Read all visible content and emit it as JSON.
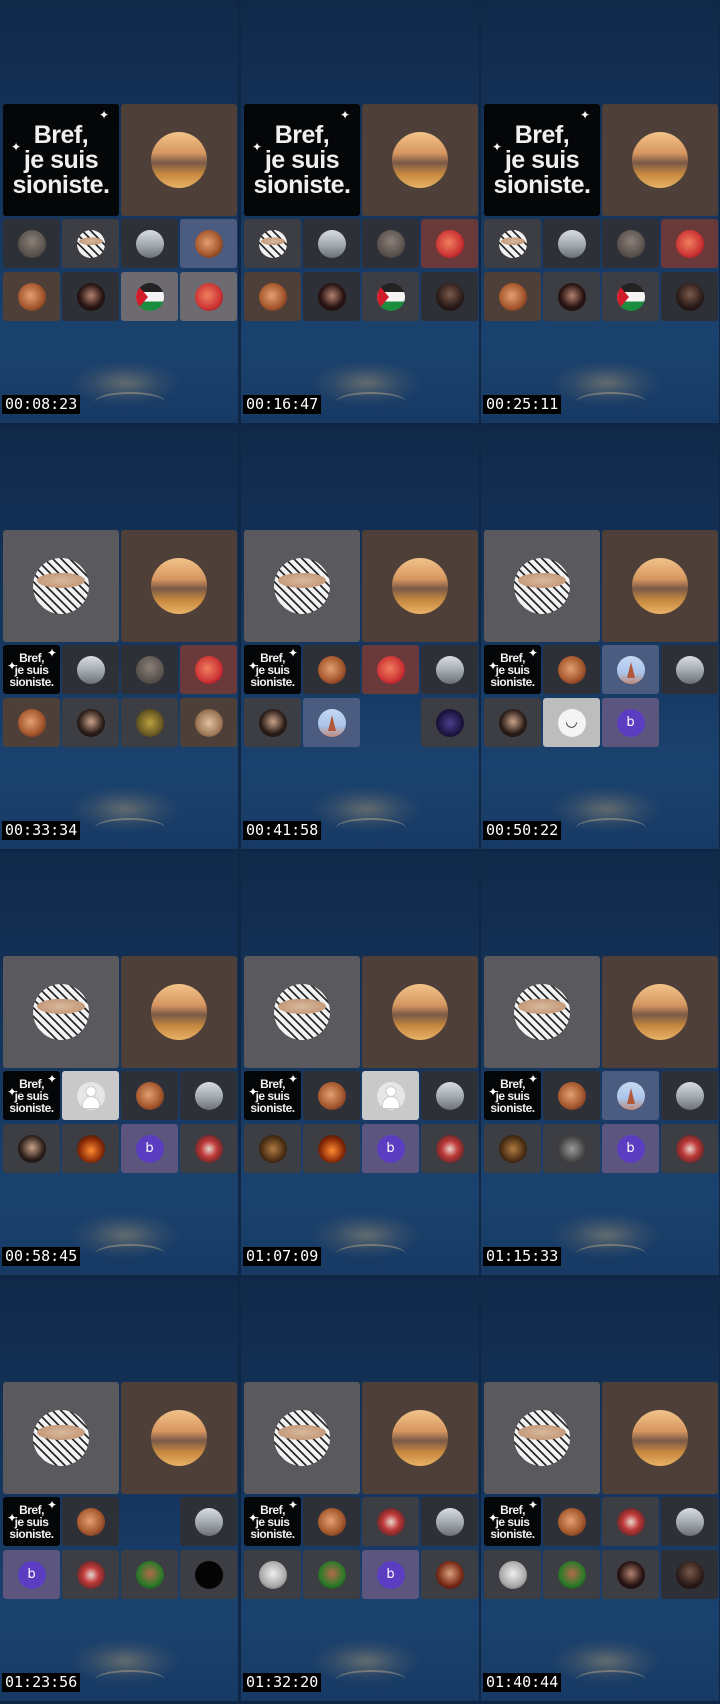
{
  "bref_text": "Bref,\nje suis\nsioniste.",
  "frames": [
    {
      "timestamp": "00:08:23",
      "tiles": [
        {
          "size": "big",
          "bg": "bref",
          "avatar": "bref"
        },
        {
          "size": "big",
          "bg": "tan",
          "avatar": "city"
        },
        {
          "size": "small",
          "bg": "dark",
          "avatar": "face"
        },
        {
          "size": "small",
          "bg": "grey",
          "avatar": "keffiyeh"
        },
        {
          "size": "small",
          "bg": "dark",
          "avatar": "car"
        },
        {
          "size": "small",
          "bg": "blue",
          "avatar": "orange"
        },
        {
          "size": "small",
          "bg": "tan",
          "avatar": "orange"
        },
        {
          "size": "small",
          "bg": "dark",
          "avatar": "woman"
        },
        {
          "size": "small",
          "bg": "light",
          "avatar": "flag"
        },
        {
          "size": "small",
          "bg": "light",
          "avatar": "red"
        }
      ]
    },
    {
      "timestamp": "00:16:47",
      "tiles": [
        {
          "size": "big",
          "bg": "bref",
          "avatar": "bref"
        },
        {
          "size": "big",
          "bg": "tan",
          "avatar": "city"
        },
        {
          "size": "small",
          "bg": "grey",
          "avatar": "keffiyeh"
        },
        {
          "size": "small",
          "bg": "dark",
          "avatar": "car"
        },
        {
          "size": "small",
          "bg": "dark",
          "avatar": "face"
        },
        {
          "size": "small",
          "bg": "red",
          "avatar": "red"
        },
        {
          "size": "small",
          "bg": "tan",
          "avatar": "orange"
        },
        {
          "size": "small",
          "bg": "dark",
          "avatar": "woman"
        },
        {
          "size": "small",
          "bg": "grey",
          "avatar": "flag"
        },
        {
          "size": "small",
          "bg": "dark",
          "avatar": "dark"
        }
      ]
    },
    {
      "timestamp": "00:25:11",
      "tiles": [
        {
          "size": "big",
          "bg": "bref",
          "avatar": "bref"
        },
        {
          "size": "big",
          "bg": "tan",
          "avatar": "city"
        },
        {
          "size": "small",
          "bg": "grey",
          "avatar": "keffiyeh"
        },
        {
          "size": "small",
          "bg": "dark",
          "avatar": "car"
        },
        {
          "size": "small",
          "bg": "dark",
          "avatar": "face"
        },
        {
          "size": "small",
          "bg": "red",
          "avatar": "red"
        },
        {
          "size": "small",
          "bg": "tan",
          "avatar": "orange"
        },
        {
          "size": "small",
          "bg": "grey",
          "avatar": "woman"
        },
        {
          "size": "small",
          "bg": "grey",
          "avatar": "flag"
        },
        {
          "size": "small",
          "bg": "dark",
          "avatar": "dark"
        }
      ]
    },
    {
      "timestamp": "00:33:34",
      "tiles": [
        {
          "size": "big",
          "bg": "gray2",
          "avatar": "keffiyeh"
        },
        {
          "size": "big",
          "bg": "tan",
          "avatar": "city"
        },
        {
          "size": "small",
          "bg": "bref",
          "avatar": "bref"
        },
        {
          "size": "small",
          "bg": "dark",
          "avatar": "car"
        },
        {
          "size": "small",
          "bg": "dark",
          "avatar": "face"
        },
        {
          "size": "small",
          "bg": "red",
          "avatar": "red"
        },
        {
          "size": "small",
          "bg": "tan",
          "avatar": "orange"
        },
        {
          "size": "small",
          "bg": "grey",
          "avatar": "beard"
        },
        {
          "size": "small",
          "bg": "grey",
          "avatar": "gold"
        },
        {
          "size": "small",
          "bg": "tan",
          "avatar": "hands"
        }
      ]
    },
    {
      "timestamp": "00:41:58",
      "tiles": [
        {
          "size": "big",
          "bg": "gray2",
          "avatar": "keffiyeh"
        },
        {
          "size": "big",
          "bg": "tan",
          "avatar": "city"
        },
        {
          "size": "small",
          "bg": "bref",
          "avatar": "bref"
        },
        {
          "size": "small",
          "bg": "dark",
          "avatar": "orange"
        },
        {
          "size": "small",
          "bg": "red",
          "avatar": "red"
        },
        {
          "size": "small",
          "bg": "dark",
          "avatar": "car"
        },
        {
          "size": "small",
          "bg": "grey",
          "avatar": "beard"
        },
        {
          "size": "small",
          "bg": "blue",
          "avatar": "eiffel"
        },
        {
          "size": "small",
          "bg": "none",
          "avatar": "none"
        },
        {
          "size": "small",
          "bg": "grey",
          "avatar": "night"
        }
      ]
    },
    {
      "timestamp": "00:50:22",
      "tiles": [
        {
          "size": "big",
          "bg": "gray2",
          "avatar": "keffiyeh"
        },
        {
          "size": "big",
          "bg": "tan",
          "avatar": "city"
        },
        {
          "size": "small",
          "bg": "bref",
          "avatar": "bref"
        },
        {
          "size": "small",
          "bg": "dark",
          "avatar": "orange"
        },
        {
          "size": "small",
          "bg": "blue",
          "avatar": "eiffel"
        },
        {
          "size": "small",
          "bg": "dark",
          "avatar": "car"
        },
        {
          "size": "small",
          "bg": "grey",
          "avatar": "beard"
        },
        {
          "size": "small",
          "bg": "whitebg",
          "avatar": "smile"
        },
        {
          "size": "small",
          "bg": "purple",
          "avatar": "b"
        },
        {
          "size": "small",
          "bg": "none",
          "avatar": "none"
        }
      ]
    },
    {
      "timestamp": "00:58:45",
      "tiles": [
        {
          "size": "big",
          "bg": "gray2",
          "avatar": "keffiyeh"
        },
        {
          "size": "big",
          "bg": "tan",
          "avatar": "city"
        },
        {
          "size": "small",
          "bg": "bref",
          "avatar": "bref"
        },
        {
          "size": "small",
          "bg": "white",
          "avatar": "person"
        },
        {
          "size": "small",
          "bg": "dark",
          "avatar": "orange"
        },
        {
          "size": "small",
          "bg": "dark",
          "avatar": "car"
        },
        {
          "size": "small",
          "bg": "grey",
          "avatar": "beard"
        },
        {
          "size": "small",
          "bg": "grey",
          "avatar": "fire"
        },
        {
          "size": "small",
          "bg": "purple",
          "avatar": "b"
        },
        {
          "size": "small",
          "bg": "grey",
          "avatar": "mask"
        }
      ]
    },
    {
      "timestamp": "01:07:09",
      "tiles": [
        {
          "size": "big",
          "bg": "gray2",
          "avatar": "keffiyeh"
        },
        {
          "size": "big",
          "bg": "tan",
          "avatar": "city"
        },
        {
          "size": "small",
          "bg": "bref",
          "avatar": "bref"
        },
        {
          "size": "small",
          "bg": "dark",
          "avatar": "orange"
        },
        {
          "size": "small",
          "bg": "white",
          "avatar": "person"
        },
        {
          "size": "small",
          "bg": "dark",
          "avatar": "car"
        },
        {
          "size": "small",
          "bg": "grey",
          "avatar": "lion"
        },
        {
          "size": "small",
          "bg": "grey",
          "avatar": "fire"
        },
        {
          "size": "small",
          "bg": "purple",
          "avatar": "b"
        },
        {
          "size": "small",
          "bg": "grey",
          "avatar": "mask"
        }
      ]
    },
    {
      "timestamp": "01:15:33",
      "tiles": [
        {
          "size": "big",
          "bg": "gray2",
          "avatar": "keffiyeh"
        },
        {
          "size": "big",
          "bg": "tan",
          "avatar": "city"
        },
        {
          "size": "small",
          "bg": "bref",
          "avatar": "bref"
        },
        {
          "size": "small",
          "bg": "dark",
          "avatar": "orange"
        },
        {
          "size": "small",
          "bg": "blue",
          "avatar": "eiffel"
        },
        {
          "size": "small",
          "bg": "dark",
          "avatar": "car"
        },
        {
          "size": "small",
          "bg": "grey",
          "avatar": "lion"
        },
        {
          "size": "small",
          "bg": "grey",
          "avatar": "smoke"
        },
        {
          "size": "small",
          "bg": "purple",
          "avatar": "b"
        },
        {
          "size": "small",
          "bg": "grey",
          "avatar": "mask"
        }
      ]
    },
    {
      "timestamp": "01:23:56",
      "tiles": [
        {
          "size": "big",
          "bg": "gray2",
          "avatar": "keffiyeh"
        },
        {
          "size": "big",
          "bg": "tan",
          "avatar": "city"
        },
        {
          "size": "small",
          "bg": "bref",
          "avatar": "bref"
        },
        {
          "size": "small",
          "bg": "dark",
          "avatar": "orange"
        },
        {
          "size": "small",
          "bg": "none",
          "avatar": "none"
        },
        {
          "size": "small",
          "bg": "dark",
          "avatar": "car"
        },
        {
          "size": "small",
          "bg": "purple",
          "avatar": "b"
        },
        {
          "size": "small",
          "bg": "grey",
          "avatar": "mask"
        },
        {
          "size": "small",
          "bg": "grey",
          "avatar": "green"
        },
        {
          "size": "small",
          "bg": "grey",
          "avatar": "black"
        }
      ]
    },
    {
      "timestamp": "01:32:20",
      "tiles": [
        {
          "size": "big",
          "bg": "gray2",
          "avatar": "keffiyeh"
        },
        {
          "size": "big",
          "bg": "tan",
          "avatar": "city"
        },
        {
          "size": "small",
          "bg": "bref",
          "avatar": "bref"
        },
        {
          "size": "small",
          "bg": "dark",
          "avatar": "orange"
        },
        {
          "size": "small",
          "bg": "grey",
          "avatar": "mask"
        },
        {
          "size": "small",
          "bg": "dark",
          "avatar": "car"
        },
        {
          "size": "small",
          "bg": "grey",
          "avatar": "statue"
        },
        {
          "size": "small",
          "bg": "grey",
          "avatar": "green"
        },
        {
          "size": "small",
          "bg": "purple",
          "avatar": "b"
        },
        {
          "size": "small",
          "bg": "grey",
          "avatar": "portrait"
        }
      ]
    },
    {
      "timestamp": "01:40:44",
      "tiles": [
        {
          "size": "big",
          "bg": "gray2",
          "avatar": "keffiyeh"
        },
        {
          "size": "big",
          "bg": "tan",
          "avatar": "city"
        },
        {
          "size": "small",
          "bg": "bref",
          "avatar": "bref"
        },
        {
          "size": "small",
          "bg": "dark",
          "avatar": "orange"
        },
        {
          "size": "small",
          "bg": "grey",
          "avatar": "mask"
        },
        {
          "size": "small",
          "bg": "dark",
          "avatar": "car"
        },
        {
          "size": "small",
          "bg": "grey",
          "avatar": "statue"
        },
        {
          "size": "small",
          "bg": "grey",
          "avatar": "green"
        },
        {
          "size": "small",
          "bg": "grey",
          "avatar": "woman"
        },
        {
          "size": "small",
          "bg": "dark",
          "avatar": "dark"
        }
      ]
    }
  ],
  "avatar_labels": {
    "b": "b"
  }
}
